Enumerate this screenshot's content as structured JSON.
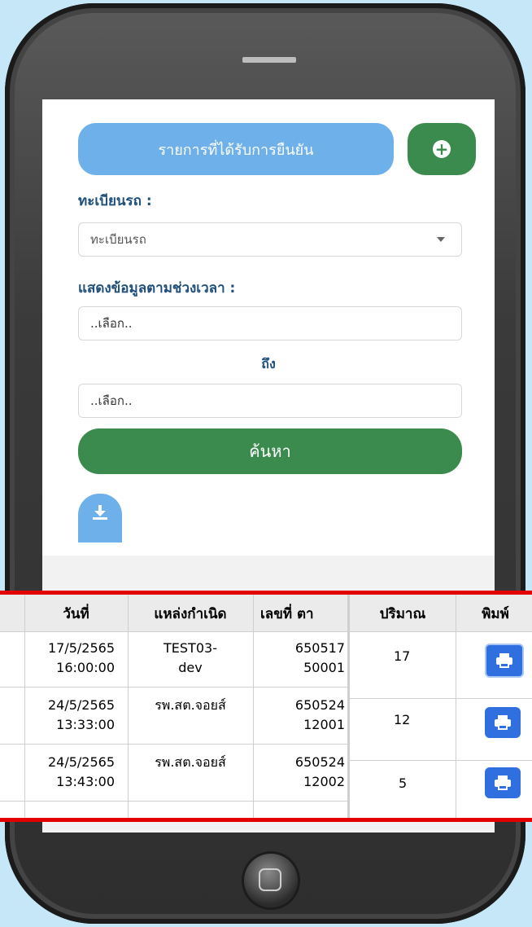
{
  "header": {
    "confirmed_label": "รายการที่ได้รับการยืนยัน"
  },
  "form": {
    "plate_label": "ทะเบียนรถ :",
    "plate_placeholder": "ทะเบียนรถ",
    "period_label": "แสดงข้อมูลตามช่วงเวลา :",
    "start_value": "..เลือก..",
    "to_label": "ถึง",
    "end_value": "..เลือก..",
    "search_label": "ค้นหา"
  },
  "table_left": {
    "headers": [
      "วันที่",
      "แหล่งกำเนิด",
      "เลขที่ ตา"
    ],
    "rows": [
      {
        "date": "17/5/2565",
        "time": "16:00:00",
        "source": "TEST03-",
        "source2": "dev",
        "no1": "650517",
        "no2": "50001"
      },
      {
        "date": "24/5/2565",
        "time": "13:33:00",
        "source": "รพ.สต.จอยส์",
        "source2": "",
        "no1": "650524",
        "no2": "12001"
      },
      {
        "date": "24/5/2565",
        "time": "13:43:00",
        "source": "รพ.สต.จอยส์",
        "source2": "",
        "no1": "650524",
        "no2": "12002"
      }
    ]
  },
  "table_right": {
    "headers": [
      "ปริมาณ",
      "พิมพ์"
    ],
    "quantities": [
      "17",
      "12",
      "5"
    ]
  },
  "colors": {
    "primary_blue": "#6db0ea",
    "green": "#3b8a4e",
    "highlight_red": "#e20000",
    "print_blue": "#2f6fe0"
  },
  "icons": [
    "plus-circle-icon",
    "chevron-down-icon",
    "download-icon",
    "printer-icon",
    "home-button-icon"
  ]
}
